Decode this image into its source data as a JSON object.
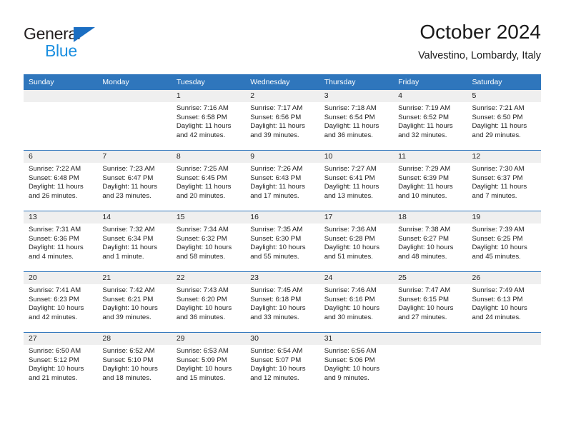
{
  "brand": {
    "name_part1": "General",
    "name_part2": "Blue",
    "accent_color": "#1b6ec2",
    "blue_text_color": "#1b8fe0"
  },
  "header": {
    "title": "October 2024",
    "subtitle": "Valvestino, Lombardy, Italy"
  },
  "theme": {
    "header_bg": "#2f76bc",
    "daynum_bg": "#efefef",
    "separator": "#2f76bc"
  },
  "weekdays": [
    "Sunday",
    "Monday",
    "Tuesday",
    "Wednesday",
    "Thursday",
    "Friday",
    "Saturday"
  ],
  "weeks": [
    [
      {
        "day": "",
        "sunrise": "",
        "sunset": "",
        "daylight_line1": "",
        "daylight_line2": ""
      },
      {
        "day": "",
        "sunrise": "",
        "sunset": "",
        "daylight_line1": "",
        "daylight_line2": ""
      },
      {
        "day": "1",
        "sunrise": "Sunrise: 7:16 AM",
        "sunset": "Sunset: 6:58 PM",
        "daylight_line1": "Daylight: 11 hours",
        "daylight_line2": "and 42 minutes."
      },
      {
        "day": "2",
        "sunrise": "Sunrise: 7:17 AM",
        "sunset": "Sunset: 6:56 PM",
        "daylight_line1": "Daylight: 11 hours",
        "daylight_line2": "and 39 minutes."
      },
      {
        "day": "3",
        "sunrise": "Sunrise: 7:18 AM",
        "sunset": "Sunset: 6:54 PM",
        "daylight_line1": "Daylight: 11 hours",
        "daylight_line2": "and 36 minutes."
      },
      {
        "day": "4",
        "sunrise": "Sunrise: 7:19 AM",
        "sunset": "Sunset: 6:52 PM",
        "daylight_line1": "Daylight: 11 hours",
        "daylight_line2": "and 32 minutes."
      },
      {
        "day": "5",
        "sunrise": "Sunrise: 7:21 AM",
        "sunset": "Sunset: 6:50 PM",
        "daylight_line1": "Daylight: 11 hours",
        "daylight_line2": "and 29 minutes."
      }
    ],
    [
      {
        "day": "6",
        "sunrise": "Sunrise: 7:22 AM",
        "sunset": "Sunset: 6:48 PM",
        "daylight_line1": "Daylight: 11 hours",
        "daylight_line2": "and 26 minutes."
      },
      {
        "day": "7",
        "sunrise": "Sunrise: 7:23 AM",
        "sunset": "Sunset: 6:47 PM",
        "daylight_line1": "Daylight: 11 hours",
        "daylight_line2": "and 23 minutes."
      },
      {
        "day": "8",
        "sunrise": "Sunrise: 7:25 AM",
        "sunset": "Sunset: 6:45 PM",
        "daylight_line1": "Daylight: 11 hours",
        "daylight_line2": "and 20 minutes."
      },
      {
        "day": "9",
        "sunrise": "Sunrise: 7:26 AM",
        "sunset": "Sunset: 6:43 PM",
        "daylight_line1": "Daylight: 11 hours",
        "daylight_line2": "and 17 minutes."
      },
      {
        "day": "10",
        "sunrise": "Sunrise: 7:27 AM",
        "sunset": "Sunset: 6:41 PM",
        "daylight_line1": "Daylight: 11 hours",
        "daylight_line2": "and 13 minutes."
      },
      {
        "day": "11",
        "sunrise": "Sunrise: 7:29 AM",
        "sunset": "Sunset: 6:39 PM",
        "daylight_line1": "Daylight: 11 hours",
        "daylight_line2": "and 10 minutes."
      },
      {
        "day": "12",
        "sunrise": "Sunrise: 7:30 AM",
        "sunset": "Sunset: 6:37 PM",
        "daylight_line1": "Daylight: 11 hours",
        "daylight_line2": "and 7 minutes."
      }
    ],
    [
      {
        "day": "13",
        "sunrise": "Sunrise: 7:31 AM",
        "sunset": "Sunset: 6:36 PM",
        "daylight_line1": "Daylight: 11 hours",
        "daylight_line2": "and 4 minutes."
      },
      {
        "day": "14",
        "sunrise": "Sunrise: 7:32 AM",
        "sunset": "Sunset: 6:34 PM",
        "daylight_line1": "Daylight: 11 hours",
        "daylight_line2": "and 1 minute."
      },
      {
        "day": "15",
        "sunrise": "Sunrise: 7:34 AM",
        "sunset": "Sunset: 6:32 PM",
        "daylight_line1": "Daylight: 10 hours",
        "daylight_line2": "and 58 minutes."
      },
      {
        "day": "16",
        "sunrise": "Sunrise: 7:35 AM",
        "sunset": "Sunset: 6:30 PM",
        "daylight_line1": "Daylight: 10 hours",
        "daylight_line2": "and 55 minutes."
      },
      {
        "day": "17",
        "sunrise": "Sunrise: 7:36 AM",
        "sunset": "Sunset: 6:28 PM",
        "daylight_line1": "Daylight: 10 hours",
        "daylight_line2": "and 51 minutes."
      },
      {
        "day": "18",
        "sunrise": "Sunrise: 7:38 AM",
        "sunset": "Sunset: 6:27 PM",
        "daylight_line1": "Daylight: 10 hours",
        "daylight_line2": "and 48 minutes."
      },
      {
        "day": "19",
        "sunrise": "Sunrise: 7:39 AM",
        "sunset": "Sunset: 6:25 PM",
        "daylight_line1": "Daylight: 10 hours",
        "daylight_line2": "and 45 minutes."
      }
    ],
    [
      {
        "day": "20",
        "sunrise": "Sunrise: 7:41 AM",
        "sunset": "Sunset: 6:23 PM",
        "daylight_line1": "Daylight: 10 hours",
        "daylight_line2": "and 42 minutes."
      },
      {
        "day": "21",
        "sunrise": "Sunrise: 7:42 AM",
        "sunset": "Sunset: 6:21 PM",
        "daylight_line1": "Daylight: 10 hours",
        "daylight_line2": "and 39 minutes."
      },
      {
        "day": "22",
        "sunrise": "Sunrise: 7:43 AM",
        "sunset": "Sunset: 6:20 PM",
        "daylight_line1": "Daylight: 10 hours",
        "daylight_line2": "and 36 minutes."
      },
      {
        "day": "23",
        "sunrise": "Sunrise: 7:45 AM",
        "sunset": "Sunset: 6:18 PM",
        "daylight_line1": "Daylight: 10 hours",
        "daylight_line2": "and 33 minutes."
      },
      {
        "day": "24",
        "sunrise": "Sunrise: 7:46 AM",
        "sunset": "Sunset: 6:16 PM",
        "daylight_line1": "Daylight: 10 hours",
        "daylight_line2": "and 30 minutes."
      },
      {
        "day": "25",
        "sunrise": "Sunrise: 7:47 AM",
        "sunset": "Sunset: 6:15 PM",
        "daylight_line1": "Daylight: 10 hours",
        "daylight_line2": "and 27 minutes."
      },
      {
        "day": "26",
        "sunrise": "Sunrise: 7:49 AM",
        "sunset": "Sunset: 6:13 PM",
        "daylight_line1": "Daylight: 10 hours",
        "daylight_line2": "and 24 minutes."
      }
    ],
    [
      {
        "day": "27",
        "sunrise": "Sunrise: 6:50 AM",
        "sunset": "Sunset: 5:12 PM",
        "daylight_line1": "Daylight: 10 hours",
        "daylight_line2": "and 21 minutes."
      },
      {
        "day": "28",
        "sunrise": "Sunrise: 6:52 AM",
        "sunset": "Sunset: 5:10 PM",
        "daylight_line1": "Daylight: 10 hours",
        "daylight_line2": "and 18 minutes."
      },
      {
        "day": "29",
        "sunrise": "Sunrise: 6:53 AM",
        "sunset": "Sunset: 5:09 PM",
        "daylight_line1": "Daylight: 10 hours",
        "daylight_line2": "and 15 minutes."
      },
      {
        "day": "30",
        "sunrise": "Sunrise: 6:54 AM",
        "sunset": "Sunset: 5:07 PM",
        "daylight_line1": "Daylight: 10 hours",
        "daylight_line2": "and 12 minutes."
      },
      {
        "day": "31",
        "sunrise": "Sunrise: 6:56 AM",
        "sunset": "Sunset: 5:06 PM",
        "daylight_line1": "Daylight: 10 hours",
        "daylight_line2": "and 9 minutes."
      },
      {
        "day": "",
        "sunrise": "",
        "sunset": "",
        "daylight_line1": "",
        "daylight_line2": ""
      },
      {
        "day": "",
        "sunrise": "",
        "sunset": "",
        "daylight_line1": "",
        "daylight_line2": ""
      }
    ]
  ]
}
